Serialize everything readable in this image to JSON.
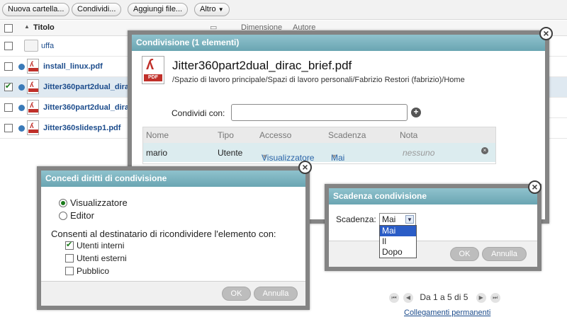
{
  "toolbar": {
    "new_folder": "Nuova cartella...",
    "share": "Condividi...",
    "add_files": "Aggiungi file...",
    "more": "Altro"
  },
  "list": {
    "header": {
      "title": "Titolo",
      "size": "Dimensione",
      "author": "Autore"
    },
    "rows": [
      {
        "name": "uffa",
        "checked": false
      },
      {
        "name": "install_linux.pdf",
        "checked": false
      },
      {
        "name": "Jitter360part2dual_dira",
        "checked": true
      },
      {
        "name": "Jitter360part2dual_dira",
        "checked": false
      },
      {
        "name": "Jitter360slidesp1.pdf",
        "checked": false
      }
    ],
    "pager": "Da 1 a 5 di 5",
    "permalink": "Collegamenti permanenti"
  },
  "share_dialog": {
    "title": "Condivisione (1 elementi)",
    "filename": "Jitter360part2dual_dirac_brief.pdf",
    "path": "/Spazio di lavoro principale/Spazi di lavoro personali/Fabrizio Restori (fabrizio)/Home",
    "pdf_label": "PDF",
    "share_with_label": "Condividi con:",
    "share_with_value": "",
    "columns": {
      "name": "Nome",
      "type": "Tipo",
      "access": "Accesso",
      "expiry": "Scadenza",
      "note": "Nota"
    },
    "row": {
      "name": "mario",
      "type": "Utente",
      "access": "Visualizzatore",
      "expiry": "Mai",
      "note": "nessuno"
    }
  },
  "rights_dialog": {
    "title": "Concedi diritti di condivisione",
    "role_viewer": "Visualizzatore",
    "role_editor": "Editor",
    "reshare_label": "Consenti al destinatario di ricondividere l'elemento con:",
    "internal_users": "Utenti interni",
    "external_users": "Utenti esterni",
    "public": "Pubblico",
    "ok": "OK",
    "cancel": "Annulla"
  },
  "expiry_dialog": {
    "title": "Scadenza condivisione",
    "label": "Scadenza:",
    "selected": "Mai",
    "options": [
      "Mai",
      "Il",
      "Dopo"
    ],
    "ok": "OK",
    "cancel": "Annulla"
  },
  "colors": {
    "dialog_title": "#7fb5c1",
    "link": "#1c4c8c",
    "accent_check": "#1a7a1a",
    "pdf_red": "#c0302a"
  }
}
